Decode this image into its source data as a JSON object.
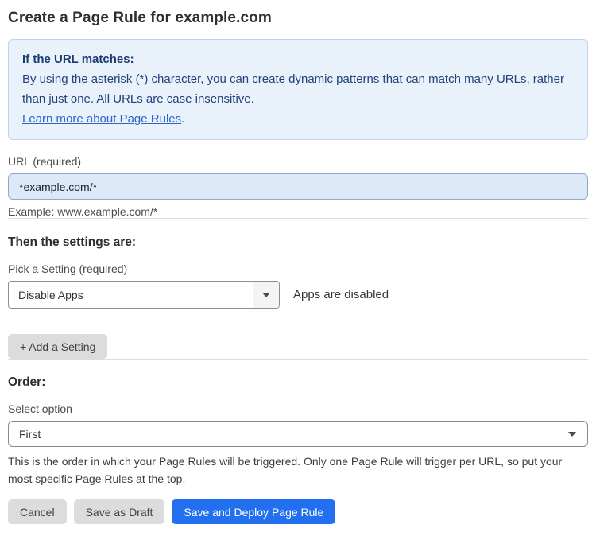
{
  "page": {
    "title": "Create a Page Rule for example.com"
  },
  "info_box": {
    "heading": "If the URL matches:",
    "body": "By using the asterisk (*) character, you can create dynamic patterns that can match many URLs, rather than just one. All URLs are case insensitive.",
    "link_label": "Learn more about Page Rules",
    "link_suffix": "."
  },
  "url_field": {
    "label": "URL (required)",
    "value": "*example.com/*",
    "helper": "Example: www.example.com/*"
  },
  "settings_section": {
    "heading": "Then the settings are:",
    "setting_label": "Pick a Setting (required)",
    "setting_value": "Disable Apps",
    "setting_status": "Apps are disabled",
    "add_setting_label": "+ Add a Setting"
  },
  "order_section": {
    "heading": "Order:",
    "select_label": "Select option",
    "select_value": "First",
    "helper": "This is the order in which your Page Rules will be triggered. Only one Page Rule will trigger per URL, so put your most specific Page Rules at the top."
  },
  "footer": {
    "cancel_label": "Cancel",
    "save_draft_label": "Save as Draft",
    "save_deploy_label": "Save and Deploy Page Rule"
  },
  "icons": {
    "dropdown_caret": "caret-down-icon",
    "select_caret": "caret-down-icon"
  },
  "colors": {
    "accent_blue": "#2270f0",
    "info_box_bg": "#e9f1fb",
    "info_box_border": "#bcd4ef",
    "info_text": "#20407a",
    "link_blue": "#2c63c9",
    "url_input_bg": "#dce9f9",
    "url_input_border": "#8fa9cb",
    "gray_button_bg": "#dcdcdc",
    "divider": "#dddddd"
  }
}
